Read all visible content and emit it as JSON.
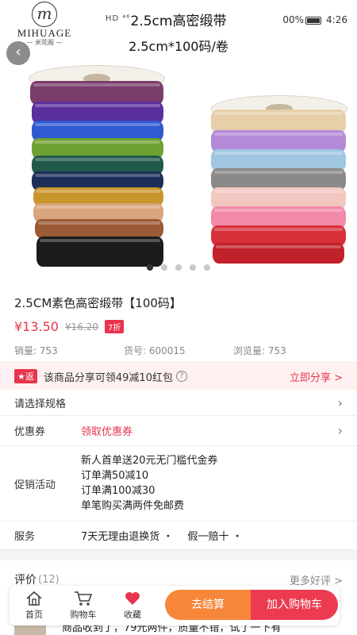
{
  "status_bar": {
    "network": "HD ⁴⁶",
    "battery": "00%",
    "time": "4:26"
  },
  "brand": {
    "name": "MIHUAGE",
    "sub": "— 米花阁 —"
  },
  "overlay": {
    "title": "2.5cm高密缎带",
    "subtitle": "2.5cm*100码/卷"
  },
  "carousel": {
    "total": 5,
    "active_index": 1
  },
  "product": {
    "title": "2.5CM素色高密缎带【100码】",
    "price": "¥13.50",
    "original_price": "¥16.20",
    "discount": "7折",
    "sales": "销量: 753",
    "sku": "货号: 600015",
    "views": "浏览量: 753"
  },
  "share": {
    "badge": "返",
    "text": "该商品分享可领49减10红包",
    "help": "?",
    "link": "立即分享 >"
  },
  "rows": {
    "spec_label": "请选择规格",
    "coupon_label": "优惠券",
    "coupon_link": "领取优惠券",
    "promo_label": "促销活动",
    "promo_items": [
      "新人首单送20元无门槛代金券",
      "订单满50减10",
      "订单满100减30",
      "单笔购买满两件免邮费"
    ],
    "service_label": "服务",
    "service_items": [
      "7天无理由退换货 ・",
      "假一赔十 ・"
    ]
  },
  "reviews": {
    "title": "评价",
    "count": "(12)",
    "more": "更多好评 >",
    "snippet": "商品收到了，79元两件，质量不错，试了一下有"
  },
  "bottom_bar": {
    "home": "首页",
    "cart": "购物车",
    "favorite": "收藏",
    "checkout": "去结算",
    "add_to_cart": "加入购物车"
  },
  "colors": {
    "accent": "#e8344e",
    "checkout": "#f6873a",
    "add_to_cart": "#ec3b51"
  }
}
